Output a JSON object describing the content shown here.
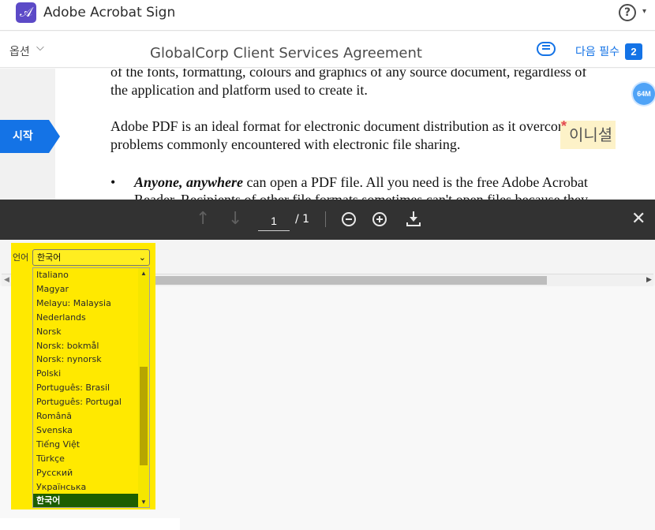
{
  "app": {
    "logo_glyph": "𝒜",
    "title": "Adobe Acrobat Sign",
    "help_glyph": "?"
  },
  "toolbar": {
    "options_label": "옵션",
    "options_chevron": "⌵",
    "document_title": "GlobalCorp Client Services Agreement",
    "next_required_label": "다음 필수",
    "next_required_count": "2"
  },
  "document": {
    "line1": "of the fonts, formatting, colours and graphics of any source document, regardless of",
    "line2": "the application and platform used to create it.",
    "line3": "Adobe PDF is an ideal format for electronic document distribution as it overcomes the",
    "line4": "problems commonly encountered with electronic file sharing.",
    "bullet_glyph": "•",
    "bullet_emph": "Anyone, anywhere",
    "bullet_rest": " can open a PDF file. All you need is the free Adobe Acrobat",
    "bullet_cut": "Reader. Recipients of other file formats sometimes can't open files because they",
    "start_tab_label": "시작",
    "badge_label": "64M",
    "required_star": "*",
    "initials_placeholder": "이니셜"
  },
  "viewer": {
    "up_glyph": "↑",
    "down_glyph": "↓",
    "page_current": "1",
    "page_total": "/ 1",
    "close_glyph": "✕"
  },
  "language": {
    "label": "언어",
    "selected": "한국어",
    "chevron": "⌄",
    "options": [
      "Italiano",
      "Magyar",
      "Melayu: Malaysia",
      "Nederlands",
      "Norsk",
      "Norsk: bokmål",
      "Norsk: nynorsk",
      "Polski",
      "Português: Brasil",
      "Português: Portugal",
      "Română",
      "Svenska",
      "Tiếng Việt",
      "Türkçe",
      "Русский",
      "Українська",
      "한국어"
    ],
    "selected_index": 16
  },
  "colors": {
    "accent": "#1473e6",
    "highlight": "#ffe900",
    "selected_item": "#1d5e00",
    "viewer_bar": "#323232"
  }
}
